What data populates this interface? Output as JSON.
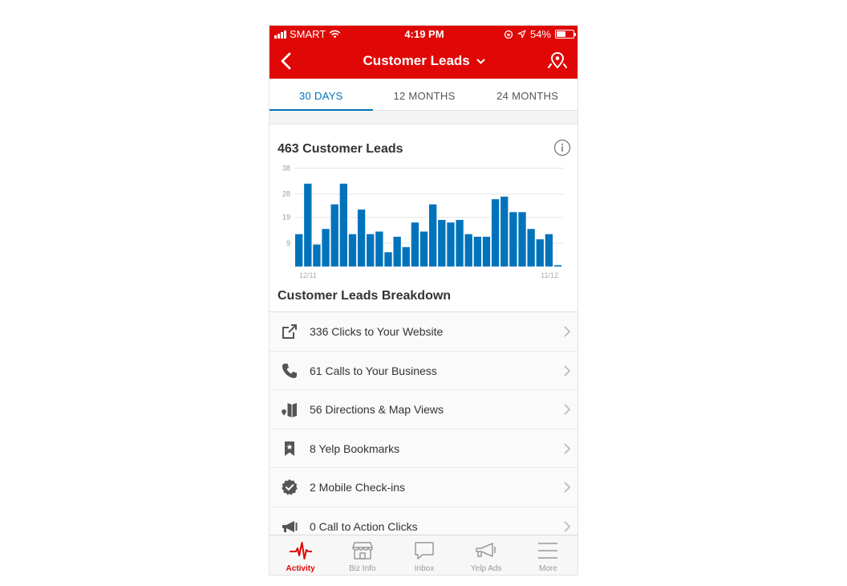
{
  "status_bar": {
    "carrier": "SMART",
    "time": "4:19 PM",
    "battery": "54%",
    "battery_level": 0.54
  },
  "nav": {
    "title": "Customer Leads"
  },
  "period_tabs": [
    "30 DAYS",
    "12 MONTHS",
    "24 MONTHS"
  ],
  "active_period": "30 DAYS",
  "summary": {
    "title": "463 Customer Leads"
  },
  "chart_data": {
    "type": "bar",
    "y_ticks": [
      "38",
      "28",
      "19",
      "9"
    ],
    "x_tick_labels": [
      "12/11",
      "11/12"
    ],
    "ylim": [
      0,
      40
    ],
    "grid": true,
    "color": "#0073bb",
    "values": [
      12.5,
      32,
      8.5,
      14.5,
      24,
      32,
      12.5,
      22,
      12.5,
      13.5,
      5.5,
      11.5,
      7.5,
      17,
      13.5,
      24,
      18,
      17,
      18,
      12.5,
      11.5,
      11.5,
      26,
      27,
      21,
      21,
      14.5,
      10.5,
      12.5,
      0.5
    ]
  },
  "breakdown": {
    "title": "Customer Leads Breakdown",
    "items": [
      {
        "label": "336 Clicks to Your Website",
        "icon": "external-link-icon"
      },
      {
        "label": "61 Calls to Your Business",
        "icon": "phone-icon"
      },
      {
        "label": "56 Directions & Map Views",
        "icon": "map-icon"
      },
      {
        "label": "8 Yelp Bookmarks",
        "icon": "bookmark-icon"
      },
      {
        "label": "2 Mobile Check-ins",
        "icon": "checkin-badge-icon"
      },
      {
        "label": "0 Call to Action Clicks",
        "icon": "megaphone-icon"
      }
    ]
  },
  "tabbar": {
    "items": [
      {
        "label": "Activity",
        "icon": "activity-icon"
      },
      {
        "label": "Biz Info",
        "icon": "storefront-icon"
      },
      {
        "label": "Inbox",
        "icon": "chat-bubble-icon"
      },
      {
        "label": "Yelp Ads",
        "icon": "megaphone-icon"
      },
      {
        "label": "More",
        "icon": "hamburger-icon"
      }
    ],
    "active": "Activity"
  },
  "colors": {
    "brand_red": "#e00707",
    "accent_blue": "#0073bb"
  }
}
